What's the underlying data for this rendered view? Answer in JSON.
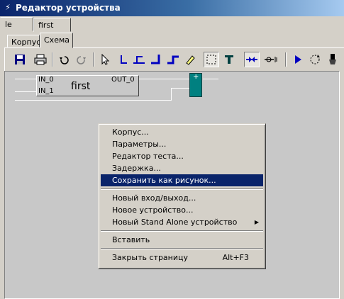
{
  "window": {
    "title": "Редактор устройства"
  },
  "doc_tabs": [
    {
      "label": "le"
    },
    {
      "label": "first"
    }
  ],
  "view_tabs": [
    {
      "label": "Корпус"
    },
    {
      "label": "Схема"
    }
  ],
  "toolbar": {
    "buttons": [
      {
        "icon": "save-icon"
      },
      {
        "icon": "print-icon"
      },
      {
        "icon": "undo-icon"
      },
      {
        "icon": "redo-icon"
      },
      {
        "icon": "pointer-icon"
      },
      {
        "icon": "wire-icon"
      },
      {
        "icon": "wire-branch-icon"
      },
      {
        "icon": "wire-corner-icon"
      },
      {
        "icon": "wire-step-icon"
      },
      {
        "icon": "eraser-icon"
      },
      {
        "icon": "select-rect-icon"
      },
      {
        "icon": "text-tool-icon"
      },
      {
        "icon": "connection-icon"
      },
      {
        "icon": "io-pin-icon"
      },
      {
        "icon": "run-icon"
      },
      {
        "icon": "rotate-icon"
      },
      {
        "icon": "brush-icon"
      }
    ],
    "accent": "#0000c0"
  },
  "schematic": {
    "block_name": "first",
    "inputs": [
      "IN_0",
      "IN_1"
    ],
    "outputs": [
      "OUT_0"
    ],
    "node_label": "+",
    "node_color": "#008080"
  },
  "context_menu": {
    "items": [
      {
        "label": "Корпус..."
      },
      {
        "label": "Параметры..."
      },
      {
        "label": "Редактор теста..."
      },
      {
        "label": "Задержка..."
      },
      {
        "label": "Сохранить как рисунок..."
      },
      {
        "label": "Новый вход/выход..."
      },
      {
        "label": "Новое устройство..."
      },
      {
        "label": "Новый Stand Alone устройство"
      },
      {
        "label": "Вставить"
      },
      {
        "label": "Закрыть страницу",
        "shortcut": "Alt+F3"
      }
    ],
    "selected_color": "#0a246a"
  }
}
